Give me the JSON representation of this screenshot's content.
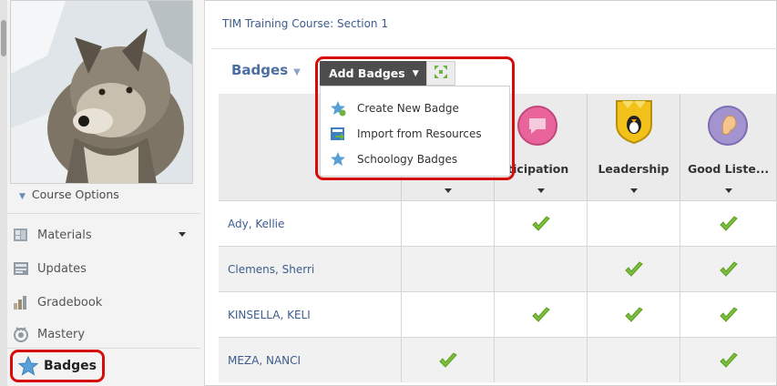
{
  "sidebar": {
    "course_options_label": "Course Options",
    "items": [
      {
        "label": "Materials",
        "icon": "materials-icon"
      },
      {
        "label": "Updates",
        "icon": "updates-icon"
      },
      {
        "label": "Gradebook",
        "icon": "gradebook-icon"
      },
      {
        "label": "Mastery",
        "icon": "mastery-icon"
      },
      {
        "label": "Badges",
        "icon": "badge-star-icon"
      }
    ]
  },
  "main": {
    "breadcrumb": "TIM Training Course: Section 1",
    "page_title": "Badges",
    "add_badges_label": "Add Badges",
    "menu": [
      {
        "label": "Create New Badge",
        "icon": "create-badge-icon"
      },
      {
        "label": "Import from Resources",
        "icon": "import-icon"
      },
      {
        "label": "Schoology Badges",
        "icon": "schoology-badge-icon"
      }
    ]
  },
  "table": {
    "columns": [
      {
        "label": "",
        "icon": ""
      },
      {
        "label": "",
        "icon": ""
      },
      {
        "label": "rticipation",
        "icon": "participation-badge-icon"
      },
      {
        "label": "Leadership",
        "icon": "leadership-badge-icon"
      },
      {
        "label": "Good Liste...",
        "icon": "good-listener-badge-icon"
      }
    ],
    "rows": [
      {
        "name": "Ady, Kellie",
        "checks": [
          false,
          true,
          false,
          true
        ]
      },
      {
        "name": "Clemens, Sherri",
        "checks": [
          false,
          false,
          true,
          true
        ]
      },
      {
        "name": "KINSELLA, KELI",
        "checks": [
          false,
          true,
          true,
          true
        ]
      },
      {
        "name": "MEZA, NANCI",
        "checks": [
          true,
          false,
          false,
          true
        ]
      }
    ]
  },
  "colors": {
    "highlight": "#d80b0b",
    "link": "#3d5c8c",
    "check": "#7cbf3a"
  }
}
